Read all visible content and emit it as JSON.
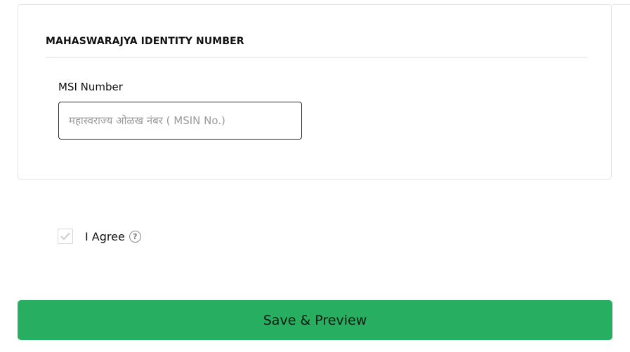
{
  "section": {
    "title": "MAHASWARAJYA IDENTITY NUMBER"
  },
  "msi_field": {
    "label": "MSI Number",
    "value": "",
    "placeholder": "महास्वराज्य ओळख नंबर ( MSIN No.)"
  },
  "agreement": {
    "label": "I Agree",
    "checked": true,
    "help_glyph": "?"
  },
  "actions": {
    "save_preview_label": "Save & Preview"
  },
  "colors": {
    "primary_button": "#27ae60",
    "check_mark": "#cfcfcf"
  },
  "icons": {
    "checkbox": "check-icon",
    "help": "question-circle-icon"
  }
}
